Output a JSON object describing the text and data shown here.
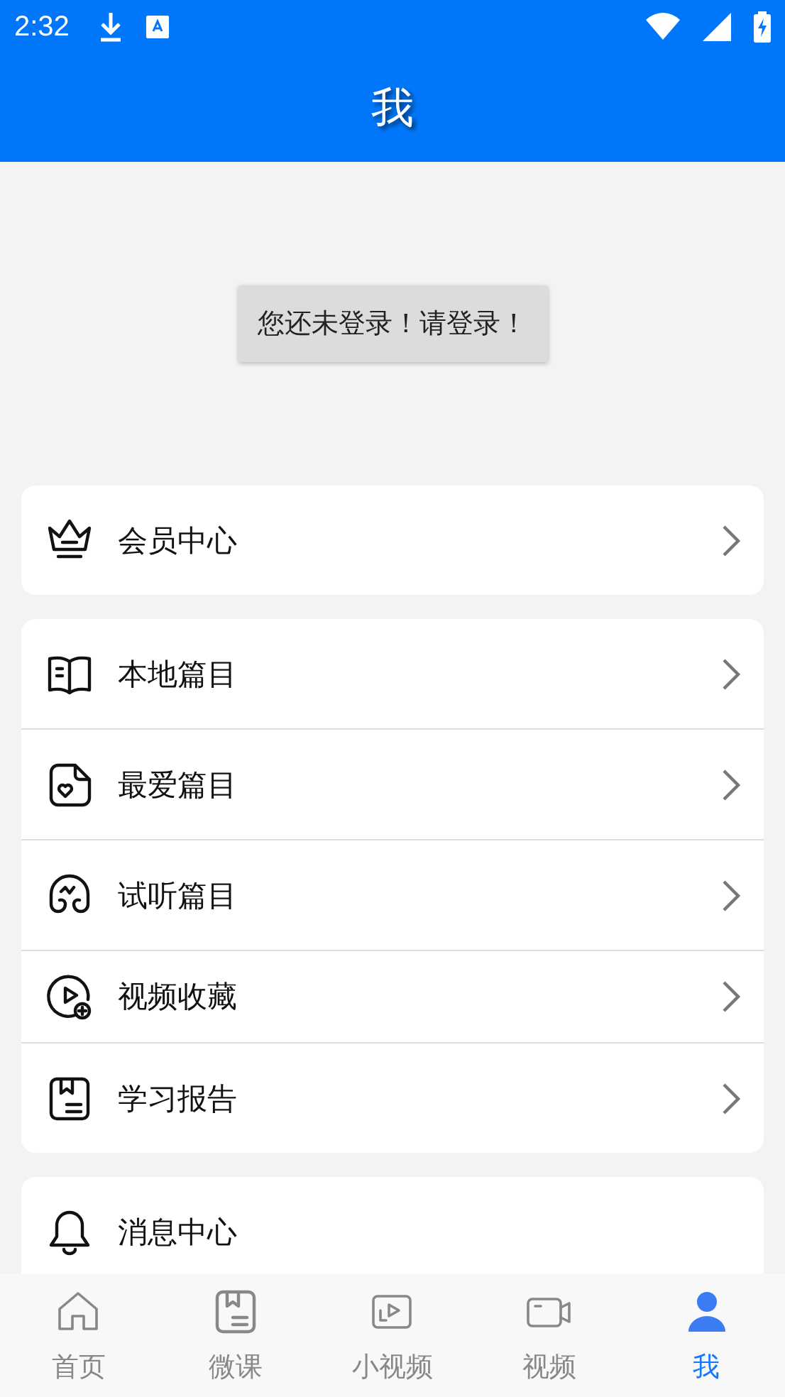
{
  "status_bar": {
    "time": "2:32"
  },
  "header": {
    "title": "我"
  },
  "login_prompt": "您还未登录！请登录！",
  "menu_groups": [
    {
      "items": [
        {
          "label": "会员中心"
        }
      ]
    },
    {
      "items": [
        {
          "label": "本地篇目"
        },
        {
          "label": "最爱篇目"
        },
        {
          "label": "试听篇目"
        },
        {
          "label": "视频收藏"
        },
        {
          "label": "学习报告"
        }
      ]
    },
    {
      "items": [
        {
          "label": "消息中心"
        }
      ]
    }
  ],
  "tab_bar": [
    {
      "label": "首页",
      "selected": false
    },
    {
      "label": "微课",
      "selected": false
    },
    {
      "label": "小视频",
      "selected": false
    },
    {
      "label": "视频",
      "selected": false
    },
    {
      "label": "我",
      "selected": true
    }
  ]
}
